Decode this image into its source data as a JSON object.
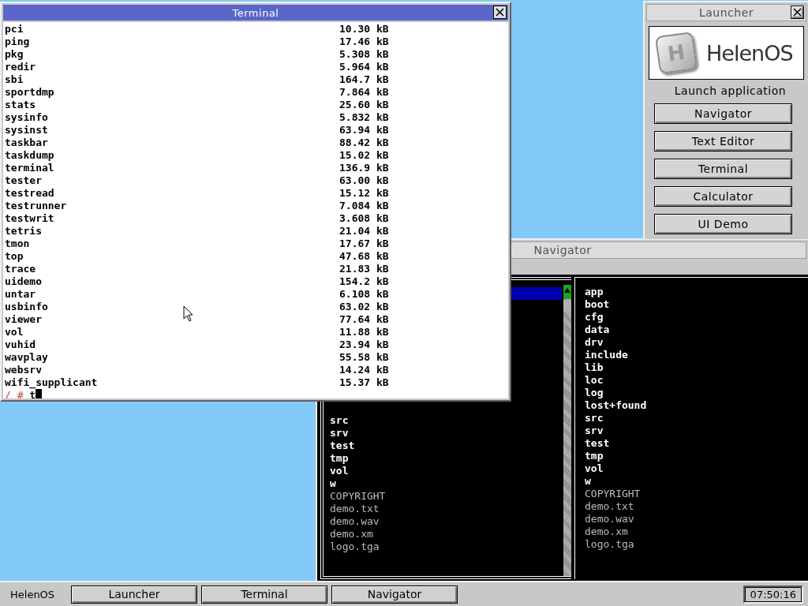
{
  "terminal": {
    "title": "Terminal",
    "active": true,
    "lines": [
      {
        "name": "pci",
        "size": "10.30 kB"
      },
      {
        "name": "ping",
        "size": "17.46 kB"
      },
      {
        "name": "pkg",
        "size": "5.308 kB"
      },
      {
        "name": "redir",
        "size": "5.964 kB"
      },
      {
        "name": "sbi",
        "size": "164.7 kB"
      },
      {
        "name": "sportdmp",
        "size": "7.864 kB"
      },
      {
        "name": "stats",
        "size": "25.60 kB"
      },
      {
        "name": "sysinfo",
        "size": "5.832 kB"
      },
      {
        "name": "sysinst",
        "size": "63.94 kB"
      },
      {
        "name": "taskbar",
        "size": "88.42 kB"
      },
      {
        "name": "taskdump",
        "size": "15.02 kB"
      },
      {
        "name": "terminal",
        "size": "136.9 kB"
      },
      {
        "name": "tester",
        "size": "63.00 kB"
      },
      {
        "name": "testread",
        "size": "15.12 kB"
      },
      {
        "name": "testrunner",
        "size": "7.084 kB"
      },
      {
        "name": "testwrit",
        "size": "3.608 kB"
      },
      {
        "name": "tetris",
        "size": "21.04 kB"
      },
      {
        "name": "tmon",
        "size": "17.67 kB"
      },
      {
        "name": "top",
        "size": "47.68 kB"
      },
      {
        "name": "trace",
        "size": "21.83 kB"
      },
      {
        "name": "uidemo",
        "size": "154.2 kB"
      },
      {
        "name": "untar",
        "size": "6.108 kB"
      },
      {
        "name": "usbinfo",
        "size": "63.02 kB"
      },
      {
        "name": "viewer",
        "size": "77.64 kB"
      },
      {
        "name": "vol",
        "size": "11.88 kB"
      },
      {
        "name": "vuhid",
        "size": "23.94 kB"
      },
      {
        "name": "wavplay",
        "size": "55.58 kB"
      },
      {
        "name": "websrv",
        "size": "14.24 kB"
      },
      {
        "name": "wifi_supplicant",
        "size": "15.37 kB"
      }
    ],
    "prompt": "/ #",
    "input": "t"
  },
  "launcher": {
    "title": "Launcher",
    "active": false,
    "logo": {
      "mark": "H",
      "wordmark": "HelenOS"
    },
    "heading": "Launch application",
    "buttons": [
      "Navigator",
      "Text Editor",
      "Terminal",
      "Calculator",
      "UI Demo"
    ]
  },
  "navigator": {
    "title": "Navigator",
    "active": false,
    "panels": [
      {
        "active": true,
        "entries": [
          {
            "name": "src",
            "kind": "dir"
          },
          {
            "name": "srv",
            "kind": "dir"
          },
          {
            "name": "test",
            "kind": "dir"
          },
          {
            "name": "tmp",
            "kind": "dir"
          },
          {
            "name": "vol",
            "kind": "dir"
          },
          {
            "name": "w",
            "kind": "dir"
          },
          {
            "name": "COPYRIGHT",
            "kind": "file"
          },
          {
            "name": "demo.txt",
            "kind": "file"
          },
          {
            "name": "demo.wav",
            "kind": "file"
          },
          {
            "name": "demo.xm",
            "kind": "file"
          },
          {
            "name": "logo.tga",
            "kind": "file"
          }
        ]
      },
      {
        "active": false,
        "entries": [
          {
            "name": "app",
            "kind": "dir"
          },
          {
            "name": "boot",
            "kind": "dir"
          },
          {
            "name": "cfg",
            "kind": "dir"
          },
          {
            "name": "data",
            "kind": "dir"
          },
          {
            "name": "drv",
            "kind": "dir"
          },
          {
            "name": "include",
            "kind": "dir"
          },
          {
            "name": "lib",
            "kind": "dir"
          },
          {
            "name": "loc",
            "kind": "dir"
          },
          {
            "name": "log",
            "kind": "dir"
          },
          {
            "name": "lost+found",
            "kind": "dir"
          },
          {
            "name": "src",
            "kind": "dir"
          },
          {
            "name": "srv",
            "kind": "dir"
          },
          {
            "name": "test",
            "kind": "dir"
          },
          {
            "name": "tmp",
            "kind": "dir"
          },
          {
            "name": "vol",
            "kind": "dir"
          },
          {
            "name": "w",
            "kind": "dir"
          },
          {
            "name": "COPYRIGHT",
            "kind": "file"
          },
          {
            "name": "demo.txt",
            "kind": "file"
          },
          {
            "name": "demo.wav",
            "kind": "file"
          },
          {
            "name": "demo.xm",
            "kind": "file"
          },
          {
            "name": "logo.tga",
            "kind": "file"
          }
        ]
      }
    ]
  },
  "taskbar": {
    "start_label": "HelenOS",
    "tasks": [
      "Launcher",
      "Terminal",
      "Navigator"
    ],
    "clock": "07:50:16"
  }
}
